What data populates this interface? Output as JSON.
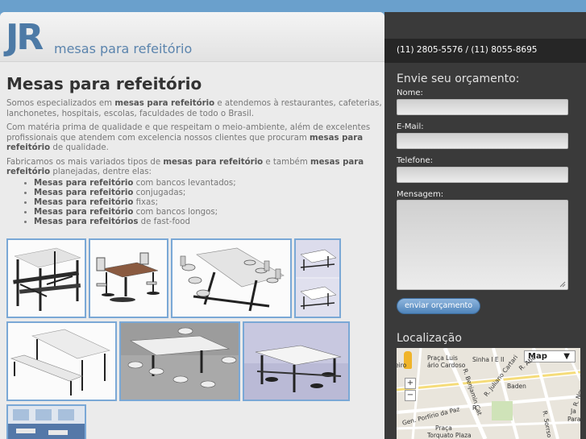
{
  "header": {
    "logo_mark": "JR",
    "logo_text": "mesas para refeitório"
  },
  "main": {
    "title": "Mesas para refeitório",
    "intro": {
      "t1": "Somos especializados em ",
      "b1": "mesas para refeitório",
      "t2": " e atendemos à restaurantes, cafeterias, lanchonetes, hospitais, escolas, faculdades de todo o Brasil."
    },
    "quality": {
      "t1": "Com matéria prima de qualidade e que respeitam o meio-ambiente, além de excelentes profissionais que atendem com excelencia nossos clientes que procuram ",
      "b1": "mesas para refeitório",
      "t2": " de qualidade."
    },
    "types": {
      "t1": "Fabricamos os mais variados tipos de ",
      "b1": "mesas para refeitório",
      "t2": " e também ",
      "b2": "mesas para refeitório",
      "t3": " planejadas, dentre elas:"
    },
    "list": [
      {
        "bold": "Mesas para refeitório",
        "rest": " com bancos levantados;"
      },
      {
        "bold": "Mesas para refeitório",
        "rest": " conjugadas;"
      },
      {
        "bold": "Mesas para refeitório",
        "rest": " fixas;"
      },
      {
        "bold": "Mesas para refeitório",
        "rest": " com bancos longos;"
      },
      {
        "bold": "Mesas para refeitórios",
        "rest": " de fast-food"
      }
    ]
  },
  "sidebar": {
    "phone": "(11) 2805-5576 / (11) 8055-8695",
    "form_title": "Envie seu orçamento:",
    "name_label": "Nome:",
    "email_label": "E-Mail:",
    "phone_label": "Telefone:",
    "message_label": "Mensagem:",
    "send_label": "enviar orçamento",
    "location_title": "Localização"
  },
  "map": {
    "type_label": "Map",
    "zoom_in": "+",
    "zoom_out": "−",
    "labels": {
      "praca_luis": "Praça Luis",
      "mario_cardoso": "ário Cardoso",
      "sinha": "Sinha I E II",
      "baden": "Baden",
      "porfirio": "Gen. Porfírio da Paz",
      "praca": "Praça",
      "torquato": "Torquato Plaza",
      "benjamin": "R. Benjamin Cat",
      "juliano": "R. Juliano Cartari",
      "nova": "R. Nova Brasilia",
      "abe": "R. Abe",
      "sorriso": "R. Sorrso",
      "ja": "Ja",
      "para": "Para",
      "eiro": "eiro",
      "rua": "R."
    }
  },
  "colors": {
    "accent": "#4d7aa6",
    "sidebar_bg": "#3a3a3a",
    "page_bg": "#ebebeb",
    "thumb_border": "#7aa8d6"
  }
}
